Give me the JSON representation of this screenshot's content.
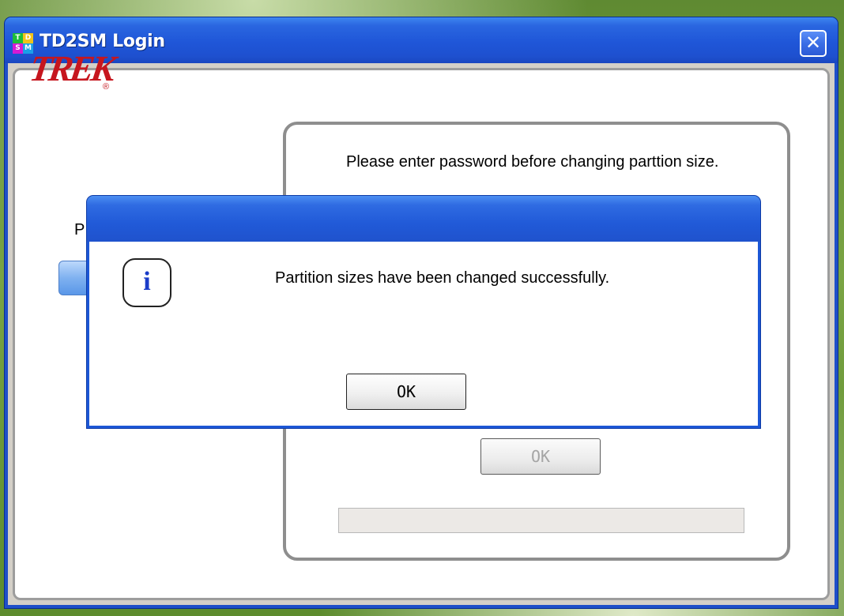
{
  "window": {
    "title": "TD2SM Login",
    "icon_letters": [
      "T",
      "D",
      "S",
      "M"
    ],
    "close_glyph": "✕"
  },
  "brand": {
    "logo_text": "TREK",
    "registered_mark": "®"
  },
  "login_panel": {
    "label_fragment": "P",
    "instruction": "Please enter password before changing parttion size.",
    "ok_label": "OK"
  },
  "dialog": {
    "icon": "info-icon",
    "icon_glyph": "i",
    "message": "Partition sizes have been changed successfully.",
    "ok_label": "OK"
  },
  "colors": {
    "title_blue": "#1f56d8",
    "brand_red": "#c6161e",
    "info_blue": "#1a3cc8"
  }
}
